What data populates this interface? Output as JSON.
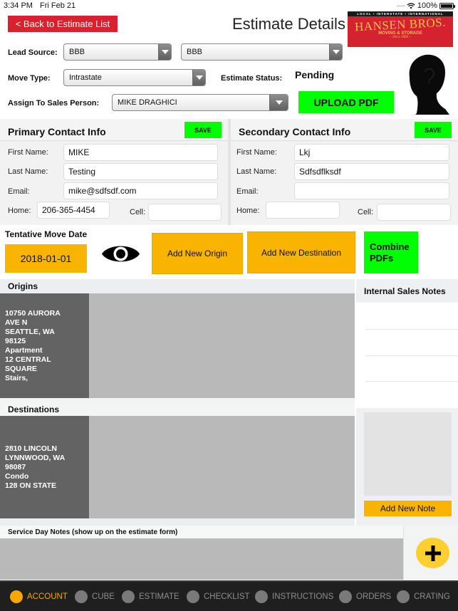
{
  "status_bar": {
    "time": "3:34 PM",
    "date": "Fri Feb 21",
    "battery": "100%"
  },
  "header": {
    "back_label": "< Back to Estimate List",
    "title": "Estimate Details",
    "logo": {
      "tagline": "LOCAL • INTERSTATE • INTERNATIONAL",
      "brand": "HANSEN BROS.",
      "subtitle": "MOVING & STORAGE",
      "since": "~ Since 1890 ~"
    }
  },
  "form": {
    "lead_source_label": "Lead Source:",
    "lead_source_value": "BBB",
    "lead_source_sub_value": "BBB",
    "move_type_label": "Move Type:",
    "move_type_value": "Intrastate",
    "estimate_status_label": "Estimate Status:",
    "estimate_status_value": "Pending",
    "sales_person_label": "Assign To Sales Person:",
    "sales_person_value": "MIKE DRAGHICI",
    "upload_pdf_label": "UPLOAD PDF"
  },
  "primary_contact": {
    "title": "Primary Contact Info",
    "save_label": "SAVE",
    "first_name_label": "First Name:",
    "first_name": "MIKE",
    "last_name_label": "Last Name:",
    "last_name": "Testing",
    "email_label": "Email:",
    "email": "mike@sdfsdf.com",
    "home_label": "Home:",
    "home": "206-365-4454",
    "cell_label": "Cell:",
    "cell": ""
  },
  "secondary_contact": {
    "title": "Secondary Contact Info",
    "save_label": "SAVE",
    "first_name_label": "First Name:",
    "first_name": "Lkj",
    "last_name_label": "Last Name:",
    "last_name": "Sdfsdflksdf",
    "email_label": "Email:",
    "email": "",
    "home_label": "Home:",
    "home": "",
    "cell_label": "Cell:",
    "cell": ""
  },
  "move": {
    "date_label": "Tentative Move Date",
    "date_value": "2018-01-01",
    "add_origin_label": "Add New Origin",
    "add_destination_label": "Add New Destination",
    "combine_pdfs_label": "Combine PDFs"
  },
  "origins": {
    "title": "Origins",
    "items": [
      {
        "lines": [
          "10750 AURORA",
          "AVE N",
          "SEATTLE, WA",
          "98125",
          "Apartment",
          "12 CENTRAL",
          "SQUARE",
          "Stairs,"
        ]
      }
    ]
  },
  "destinations": {
    "title": "Destinations",
    "items": [
      {
        "lines": [
          "2810 LINCOLN",
          "LYNNWOOD, WA",
          "98087",
          "Condo",
          "128 ON STATE"
        ]
      }
    ]
  },
  "sales_notes": {
    "title": "Internal Sales Notes",
    "add_label": "Add New Note"
  },
  "service_notes": {
    "title": "Service Day Notes (show up on the estimate form)"
  },
  "tabs": [
    {
      "label": "ACCOUNT",
      "active": true
    },
    {
      "label": "CUBE",
      "active": false
    },
    {
      "label": "ESTIMATE",
      "active": false
    },
    {
      "label": "CHECKLIST",
      "active": false
    },
    {
      "label": "INSTRUCTIONS",
      "active": false
    },
    {
      "label": "ORDERS",
      "active": false
    },
    {
      "label": "CRATING",
      "active": false
    }
  ],
  "colors": {
    "back_button": "#d9212e",
    "action_green": "#00ff00",
    "action_yellow": "#f8b400",
    "tab_active": "#f6a800",
    "plus_button": "#fdcf31"
  }
}
